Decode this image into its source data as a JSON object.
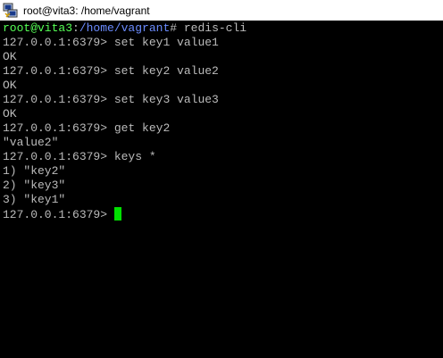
{
  "window": {
    "title": "root@vita3: /home/vagrant",
    "icon": "putty-icon"
  },
  "terminal": {
    "shell_prompt": {
      "user_host": "root@vita3",
      "separator": ":",
      "path": "/home/vagrant",
      "symbol": "#",
      "command": " redis-cli"
    },
    "redis_prompt": "127.0.0.1:6379>",
    "lines": [
      {
        "prompt": "127.0.0.1:6379>",
        "command": " set key1 value1"
      },
      {
        "output": "OK"
      },
      {
        "prompt": "127.0.0.1:6379>",
        "command": " set key2 value2"
      },
      {
        "output": "OK"
      },
      {
        "prompt": "127.0.0.1:6379>",
        "command": " set key3 value3"
      },
      {
        "output": "OK"
      },
      {
        "prompt": "127.0.0.1:6379>",
        "command": " get key2"
      },
      {
        "output": "\"value2\""
      },
      {
        "prompt": "127.0.0.1:6379>",
        "command": " keys *"
      },
      {
        "output": "1) \"key2\""
      },
      {
        "output": "2) \"key3\""
      },
      {
        "output": "3) \"key1\""
      }
    ],
    "current_prompt": "127.0.0.1:6379> ",
    "cursor_color": "#00e000"
  },
  "colors": {
    "background": "#000000",
    "text": "#bbbbbb",
    "user_host": "#55ff55",
    "path": "#6b8cff"
  }
}
